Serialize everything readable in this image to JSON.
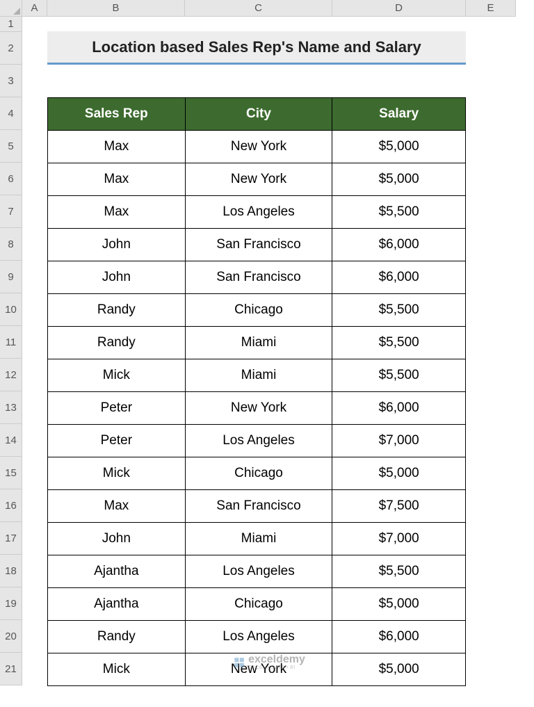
{
  "columns": [
    "A",
    "B",
    "C",
    "D",
    "E"
  ],
  "rowCount": 22,
  "title": "Location based Sales Rep's Name and Salary",
  "headers": {
    "col1": "Sales Rep",
    "col2": "City",
    "col3": "Salary"
  },
  "rows": [
    {
      "rep": "Max",
      "city": "New York",
      "salary": "$5,000"
    },
    {
      "rep": "Max",
      "city": "New York",
      "salary": "$5,000"
    },
    {
      "rep": "Max",
      "city": "Los Angeles",
      "salary": "$5,500"
    },
    {
      "rep": "John",
      "city": "San Francisco",
      "salary": "$6,000"
    },
    {
      "rep": "John",
      "city": "San Francisco",
      "salary": "$6,000"
    },
    {
      "rep": "Randy",
      "city": "Chicago",
      "salary": "$5,500"
    },
    {
      "rep": "Randy",
      "city": "Miami",
      "salary": "$5,500"
    },
    {
      "rep": "Mick",
      "city": "Miami",
      "salary": "$5,500"
    },
    {
      "rep": "Peter",
      "city": "New York",
      "salary": "$6,000"
    },
    {
      "rep": "Peter",
      "city": "Los Angeles",
      "salary": "$7,000"
    },
    {
      "rep": "Mick",
      "city": "Chicago",
      "salary": "$5,000"
    },
    {
      "rep": "Max",
      "city": "San Francisco",
      "salary": "$7,500"
    },
    {
      "rep": "John",
      "city": "Miami",
      "salary": "$7,000"
    },
    {
      "rep": "Ajantha",
      "city": "Los Angeles",
      "salary": "$5,500"
    },
    {
      "rep": "Ajantha",
      "city": "Chicago",
      "salary": "$5,000"
    },
    {
      "rep": "Randy",
      "city": "Los Angeles",
      "salary": "$6,000"
    },
    {
      "rep": "Mick",
      "city": "New York",
      "salary": "$5,000"
    }
  ],
  "watermark": {
    "main": "exceldemy",
    "sub": "EXCEL • DATA • BI"
  }
}
